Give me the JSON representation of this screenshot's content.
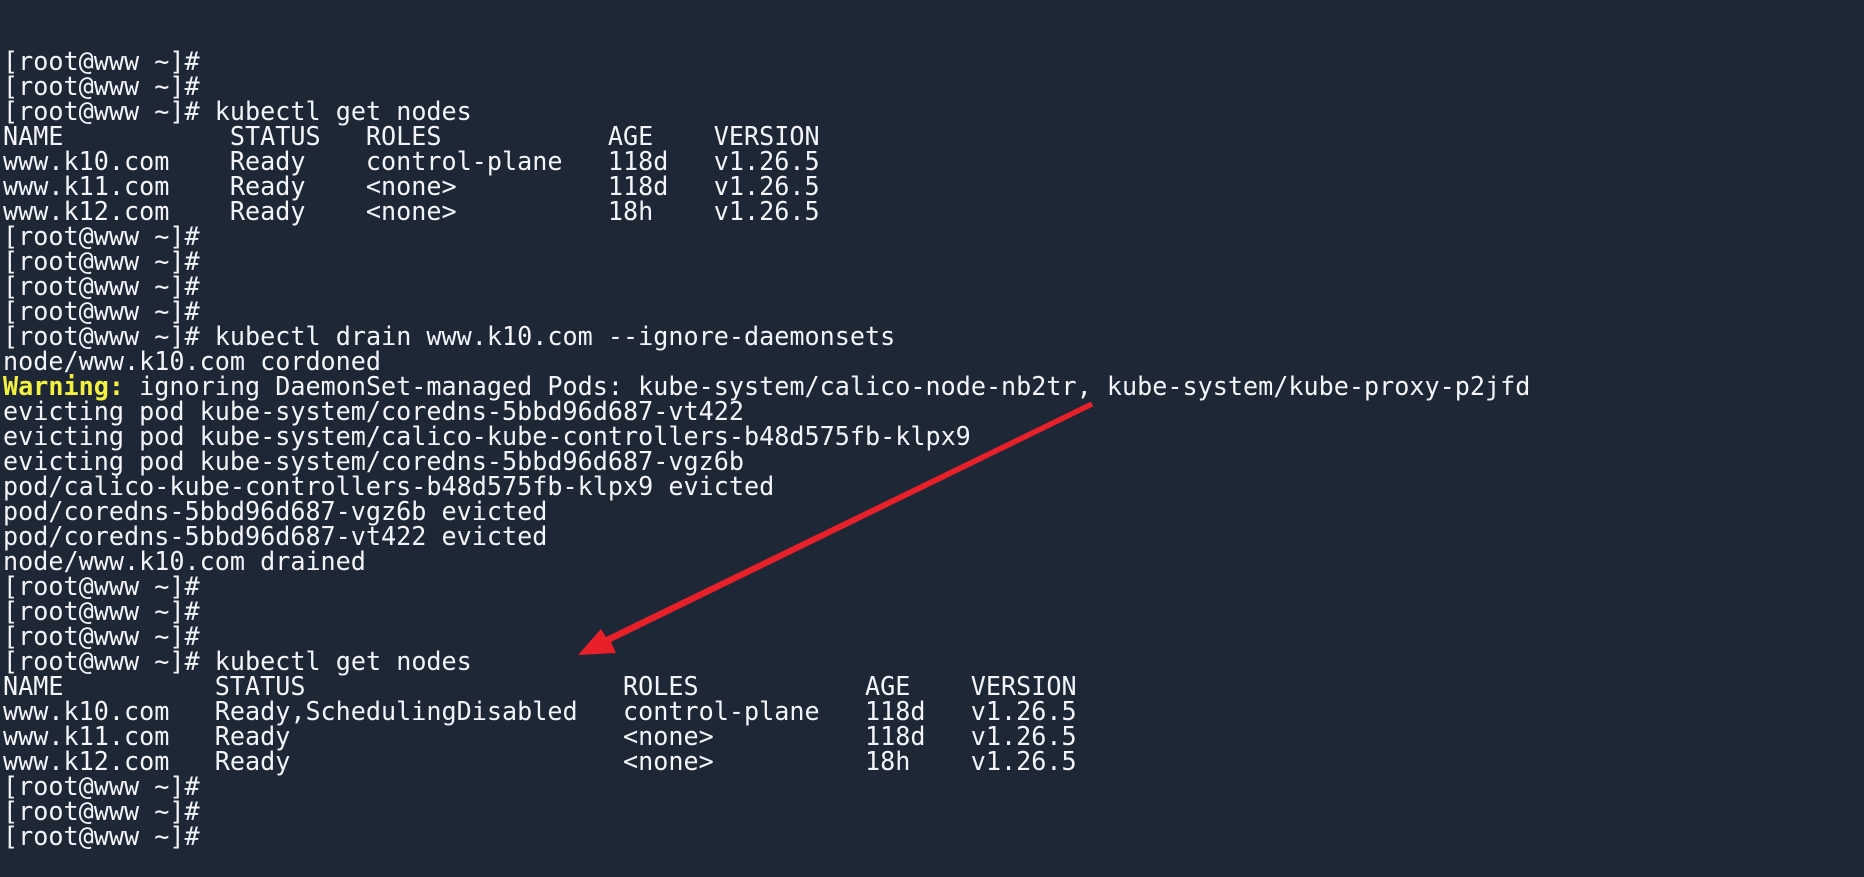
{
  "terminal": {
    "prompt": "[root@www ~]#",
    "colors": {
      "background": "#1d2736",
      "foreground": "#f2f4f7",
      "warning": "#f4f040",
      "annotation_arrow": "#e8202a"
    },
    "lines": [
      {
        "kind": "prompt",
        "command": ""
      },
      {
        "kind": "prompt",
        "command": ""
      },
      {
        "kind": "prompt",
        "command": "kubectl get nodes"
      },
      {
        "kind": "output",
        "text": "NAME           STATUS   ROLES           AGE    VERSION"
      },
      {
        "kind": "output",
        "text": "www.k10.com    Ready    control-plane   118d   v1.26.5"
      },
      {
        "kind": "output",
        "text": "www.k11.com    Ready    <none>          118d   v1.26.5"
      },
      {
        "kind": "output",
        "text": "www.k12.com    Ready    <none>          18h    v1.26.5"
      },
      {
        "kind": "prompt",
        "command": ""
      },
      {
        "kind": "prompt",
        "command": ""
      },
      {
        "kind": "prompt",
        "command": ""
      },
      {
        "kind": "prompt",
        "command": ""
      },
      {
        "kind": "prompt",
        "command": "kubectl drain www.k10.com --ignore-daemonsets"
      },
      {
        "kind": "output",
        "text": "node/www.k10.com cordoned"
      },
      {
        "kind": "warning",
        "label": "Warning:",
        "text": " ignoring DaemonSet-managed Pods: kube-system/calico-node-nb2tr, kube-system/kube-proxy-p2jfd"
      },
      {
        "kind": "output",
        "text": "evicting pod kube-system/coredns-5bbd96d687-vt422"
      },
      {
        "kind": "output",
        "text": "evicting pod kube-system/calico-kube-controllers-b48d575fb-klpx9"
      },
      {
        "kind": "output",
        "text": "evicting pod kube-system/coredns-5bbd96d687-vgz6b"
      },
      {
        "kind": "output",
        "text": "pod/calico-kube-controllers-b48d575fb-klpx9 evicted"
      },
      {
        "kind": "output",
        "text": "pod/coredns-5bbd96d687-vgz6b evicted"
      },
      {
        "kind": "output",
        "text": "pod/coredns-5bbd96d687-vt422 evicted"
      },
      {
        "kind": "output",
        "text": "node/www.k10.com drained"
      },
      {
        "kind": "prompt",
        "command": ""
      },
      {
        "kind": "prompt",
        "command": ""
      },
      {
        "kind": "prompt",
        "command": ""
      },
      {
        "kind": "prompt",
        "command": "kubectl get nodes"
      },
      {
        "kind": "output",
        "text": "NAME          STATUS                     ROLES           AGE    VERSION"
      },
      {
        "kind": "output",
        "text": "www.k10.com   Ready,SchedulingDisabled   control-plane   118d   v1.26.5"
      },
      {
        "kind": "output",
        "text": "www.k11.com   Ready                      <none>          118d   v1.26.5"
      },
      {
        "kind": "output",
        "text": "www.k12.com   Ready                      <none>          18h    v1.26.5"
      },
      {
        "kind": "prompt",
        "command": ""
      },
      {
        "kind": "prompt",
        "command": ""
      },
      {
        "kind": "prompt",
        "command": ""
      }
    ]
  },
  "annotation": {
    "type": "arrow",
    "points_to": "Ready,SchedulingDisabled"
  }
}
